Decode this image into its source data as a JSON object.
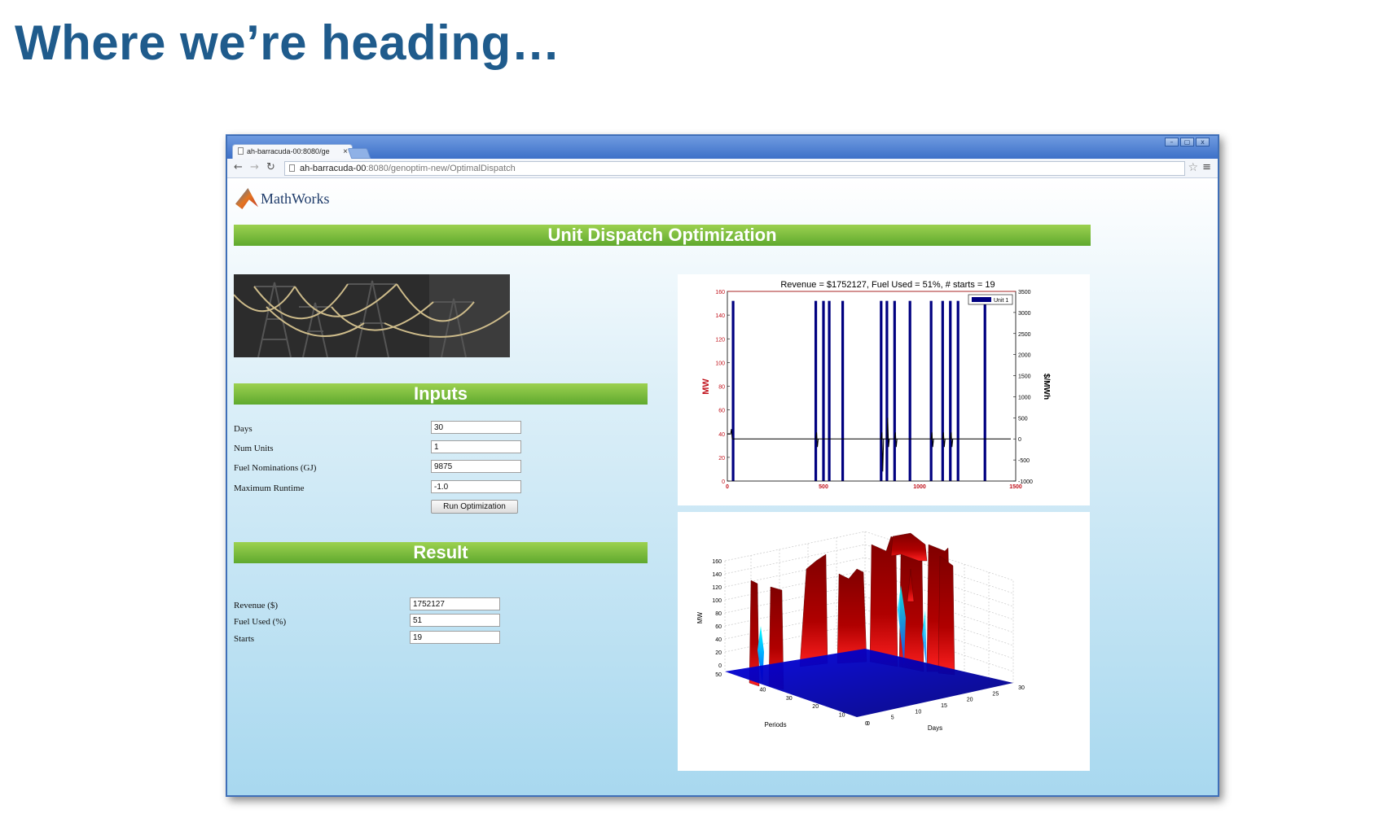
{
  "slide": {
    "title": "Where we’re heading…"
  },
  "browser": {
    "tab_title": "ah-barracuda-00:8080/ge",
    "url_host": "ah-barracuda-00",
    "url_path": ":8080/genoptim-new/OptimalDispatch",
    "window_buttons": [
      "–",
      "▢",
      "x"
    ]
  },
  "app": {
    "logo_text": "MathWorks",
    "title": "Unit Dispatch Optimization",
    "inputs_header": "Inputs",
    "result_header": "Result",
    "inputs": [
      {
        "label": "Days",
        "value": "30"
      },
      {
        "label": "Num Units",
        "value": "1"
      },
      {
        "label": "Fuel Nominations (GJ)",
        "value": "9875"
      },
      {
        "label": "Maximum Runtime",
        "value": "-1.0"
      }
    ],
    "run_button": "Run Optimization",
    "results": [
      {
        "label": "Revenue ($)",
        "value": "1752127"
      },
      {
        "label": "Fuel Used (%)",
        "value": "51"
      },
      {
        "label": "Starts",
        "value": "19"
      }
    ]
  },
  "chart_data": [
    {
      "type": "bar",
      "title": "Revenue = $1752127, Fuel Used = 51%, # starts = 19",
      "ylabel": "MW",
      "ylabel_right": "$/MWh",
      "ylim": [
        0,
        160
      ],
      "ylim_right": [
        -1000,
        3500
      ],
      "xlim": [
        0,
        1500
      ],
      "x_ticks": [
        0,
        500,
        1000,
        1500
      ],
      "y_ticks": [
        0,
        20,
        40,
        60,
        80,
        100,
        120,
        140,
        160
      ],
      "y_ticks_right": [
        -1000,
        -500,
        0,
        500,
        1000,
        1500,
        2000,
        2500,
        3000,
        3500
      ],
      "legend": {
        "entries": [
          "Unit 1"
        ],
        "placement": "top-right"
      },
      "series": [
        {
          "name": "Unit 1",
          "color": "#000080",
          "x": [
            30,
            460,
            500,
            530,
            600,
            800,
            830,
            870,
            950,
            1060,
            1120,
            1160,
            1200,
            1340
          ],
          "values": [
            152,
            152,
            152,
            152,
            152,
            152,
            152,
            152,
            152,
            152,
            152,
            152,
            152,
            152
          ]
        }
      ],
      "price_baseline": 0,
      "price_color": "#000000"
    },
    {
      "type": "surface",
      "zlabel": "MW",
      "xlabel": "Days",
      "ylabel": "Periods",
      "z_ticks": [
        0,
        20,
        40,
        60,
        80,
        100,
        120,
        140,
        160
      ],
      "x_ticks": [
        0,
        5,
        10,
        15,
        20,
        25,
        30
      ],
      "y_ticks": [
        0,
        10,
        20,
        30,
        40,
        50
      ],
      "colormap": [
        "#00008f",
        "#0000ff",
        "#00ffff",
        "#ff0000",
        "#800000"
      ]
    }
  ]
}
